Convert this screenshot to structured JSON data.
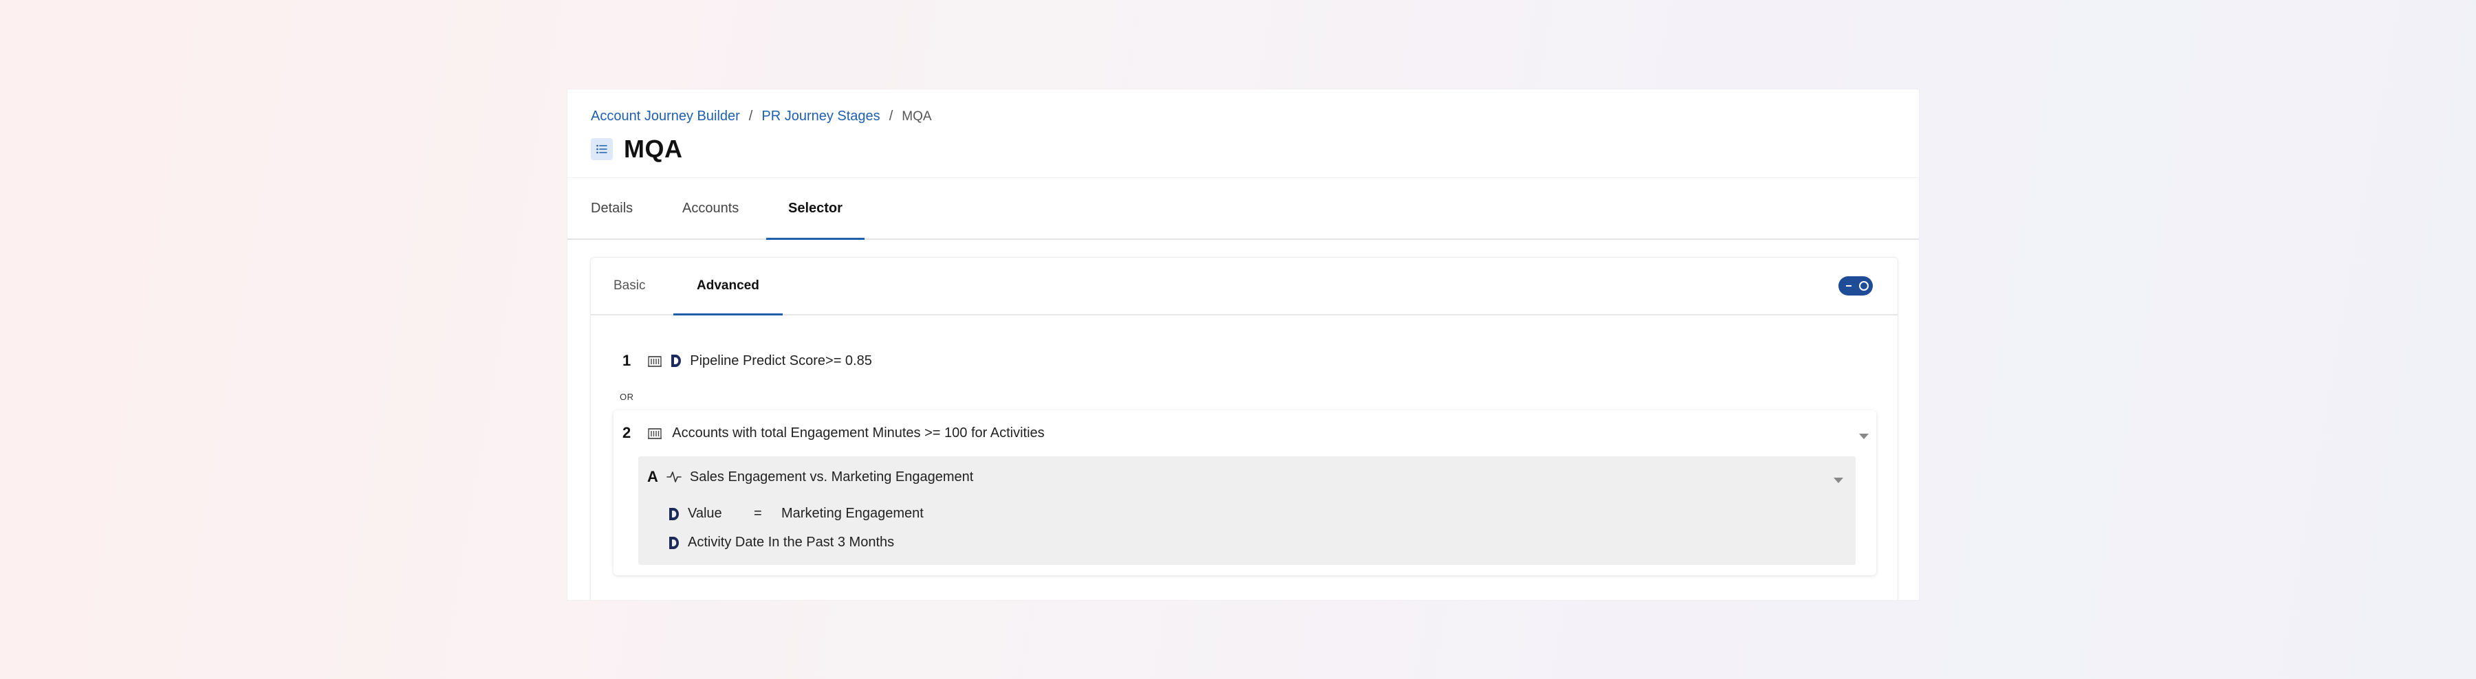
{
  "breadcrumb": {
    "items": [
      "Account Journey Builder",
      "PR Journey Stages"
    ],
    "separator": "/",
    "current": "MQA"
  },
  "page": {
    "title": "MQA",
    "title_icon": "list-icon"
  },
  "main_tabs": [
    {
      "label": "Details",
      "active": false
    },
    {
      "label": "Accounts",
      "active": false
    },
    {
      "label": "Selector",
      "active": true
    }
  ],
  "selector": {
    "sub_tabs": [
      {
        "label": "Basic",
        "active": false
      },
      {
        "label": "Advanced",
        "active": true
      }
    ],
    "toggle": {
      "on": true
    },
    "rules": [
      {
        "number": "1",
        "icons": [
          "building-icon",
          "d-logo-icon"
        ],
        "text": "Pipeline Predict Score>= 0.85"
      }
    ],
    "connector": "OR",
    "group": {
      "number": "2",
      "icon": "building-icon",
      "text": "Accounts with total Engagement Minutes >= 100  for Activities",
      "sub_group": {
        "letter": "A",
        "icon": "activity-icon",
        "title": "Sales Engagement vs. Marketing Engagement",
        "conditions": [
          {
            "icon": "d-logo-icon",
            "field": "Value",
            "operator": "=",
            "value": "Marketing Engagement"
          },
          {
            "icon": "d-logo-icon",
            "text": "Activity Date In the Past 3 Months"
          }
        ]
      }
    }
  },
  "colors": {
    "accent": "#1f5fae",
    "toggle": "#1f4c96",
    "subgroup_bg": "#efefef"
  }
}
